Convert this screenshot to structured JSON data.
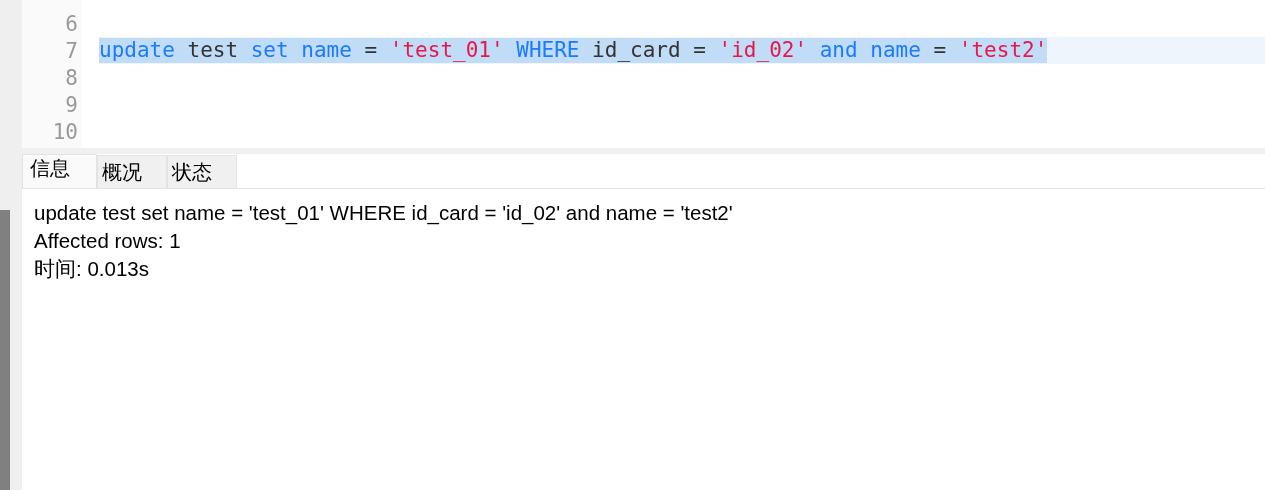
{
  "editor": {
    "lines": [
      {
        "number": "6",
        "selected": false
      },
      {
        "number": "7",
        "selected": true,
        "tokens": [
          {
            "kind": "keyword",
            "text": "update"
          },
          {
            "kind": "plain",
            "text": "test"
          },
          {
            "kind": "keyword",
            "text": "set"
          },
          {
            "kind": "keyword",
            "text": "name"
          },
          {
            "kind": "plain",
            "text": "="
          },
          {
            "kind": "string",
            "text": "'test_01'"
          },
          {
            "kind": "keyword",
            "text": "WHERE"
          },
          {
            "kind": "plain",
            "text": "id_card"
          },
          {
            "kind": "plain",
            "text": "="
          },
          {
            "kind": "string",
            "text": "'id_02'"
          },
          {
            "kind": "keyword",
            "text": "and"
          },
          {
            "kind": "keyword",
            "text": "name"
          },
          {
            "kind": "plain",
            "text": "="
          },
          {
            "kind": "string",
            "text": "'test2'"
          }
        ]
      },
      {
        "number": "8",
        "selected": false
      },
      {
        "number": "9",
        "selected": false
      },
      {
        "number": "10",
        "selected": false
      }
    ]
  },
  "tabs": [
    {
      "label": "信息",
      "selected": true
    },
    {
      "label": "概况",
      "selected": false
    },
    {
      "label": "状态",
      "selected": false
    }
  ],
  "output": [
    "update test set name = 'test_01' WHERE id_card = 'id_02' and name = 'test2'",
    "Affected rows: 1",
    "时间: 0.013s"
  ]
}
